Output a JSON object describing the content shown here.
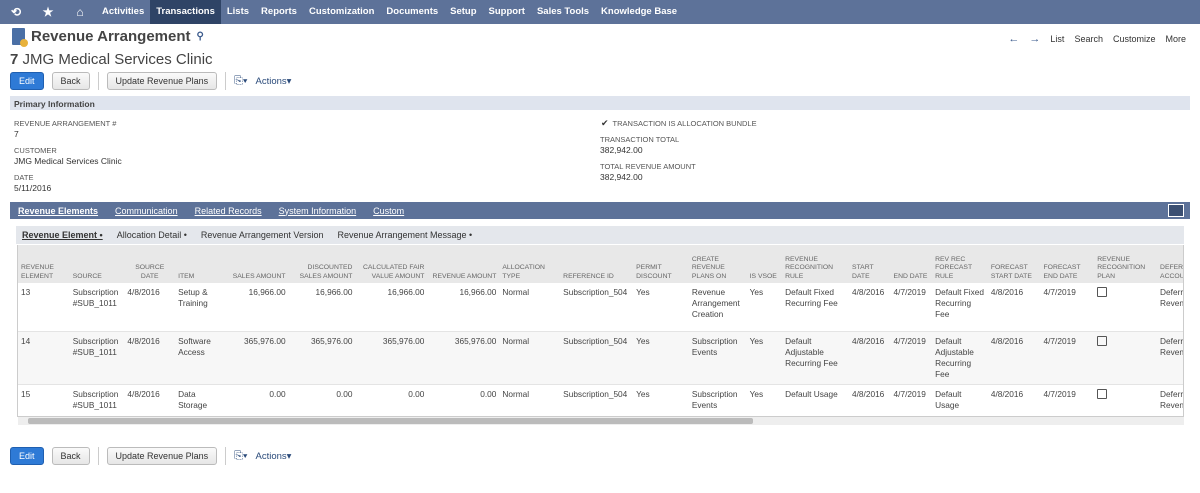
{
  "nav": {
    "items": [
      "Activities",
      "Transactions",
      "Lists",
      "Reports",
      "Customization",
      "Documents",
      "Setup",
      "Support",
      "Sales Tools",
      "Knowledge Base"
    ],
    "active": "Transactions"
  },
  "header": {
    "title": "Revenue Arrangement",
    "number": "7",
    "name": "JMG Medical Services Clinic",
    "right": [
      "List",
      "Search",
      "Customize",
      "More"
    ]
  },
  "buttons": {
    "edit": "Edit",
    "back": "Back",
    "update": "Update Revenue Plans",
    "actions": "Actions"
  },
  "primary": {
    "section": "Primary Information",
    "fields": [
      {
        "label": "Revenue Arrangement #",
        "value": "7"
      },
      {
        "label": "Customer",
        "value": "JMG Medical Services Clinic"
      },
      {
        "label": "Date",
        "value": "5/11/2016"
      }
    ],
    "allocation_bundle": "Transaction is Allocation Bundle",
    "allocation_bundle_checked": true,
    "right_fields": [
      {
        "label": "Transaction Total",
        "value": "382,942.00"
      },
      {
        "label": "Total Revenue Amount",
        "value": "382,942.00"
      }
    ]
  },
  "tabs": [
    "Revenue Elements",
    "Communication",
    "Related Records",
    "System Information",
    "Custom"
  ],
  "subtabs": [
    "Revenue Element •",
    "Allocation Detail •",
    "Revenue Arrangement Version",
    "Revenue Arrangement Message •"
  ],
  "table": {
    "headers": [
      "Revenue Element",
      "Source",
      "Source Date",
      "Item",
      "Sales Amount",
      "Discounted Sales Amount",
      "Calculated Fair Value Amount",
      "Revenue Amount",
      "Allocation Type",
      "Reference ID",
      "Permit Discount",
      "Create Revenue Plans On",
      "Is VSOE",
      "Revenue Recognition Rule",
      "Start Date",
      "End Date",
      "Rev Rec Forecast Rule",
      "Forecast Start Date",
      "Forecast End Date",
      "Revenue Recognition Plan",
      "Deferral Account"
    ],
    "rows": [
      [
        "13",
        "Subscription #SUB_1011",
        "4/8/2016",
        "Setup & Training",
        "16,966.00",
        "16,966.00",
        "16,966.00",
        "16,966.00",
        "Normal",
        "Subscription_504",
        "Yes",
        "Revenue Arrangement Creation",
        "Yes",
        "Default Fixed Recurring Fee",
        "4/8/2016",
        "4/7/2019",
        "Default Fixed Recurring Fee",
        "4/8/2016",
        "4/7/2019",
        "",
        "Deferred Revenue"
      ],
      [
        "14",
        "Subscription #SUB_1011",
        "4/8/2016",
        "Software Access",
        "365,976.00",
        "365,976.00",
        "365,976.00",
        "365,976.00",
        "Normal",
        "Subscription_504",
        "Yes",
        "Subscription Events",
        "Yes",
        "Default Adjustable Recurring Fee",
        "4/8/2016",
        "4/7/2019",
        "Default Adjustable Recurring Fee",
        "4/8/2016",
        "4/7/2019",
        "",
        "Deferred Revenue"
      ],
      [
        "15",
        "Subscription #SUB_1011",
        "4/8/2016",
        "Data Storage",
        "0.00",
        "0.00",
        "0.00",
        "0.00",
        "Normal",
        "Subscription_504",
        "Yes",
        "Subscription Events",
        "Yes",
        "Default Usage",
        "4/8/2016",
        "4/7/2019",
        "Default Usage",
        "4/8/2016",
        "4/7/2019",
        "",
        "Deferred Revenue"
      ]
    ]
  }
}
